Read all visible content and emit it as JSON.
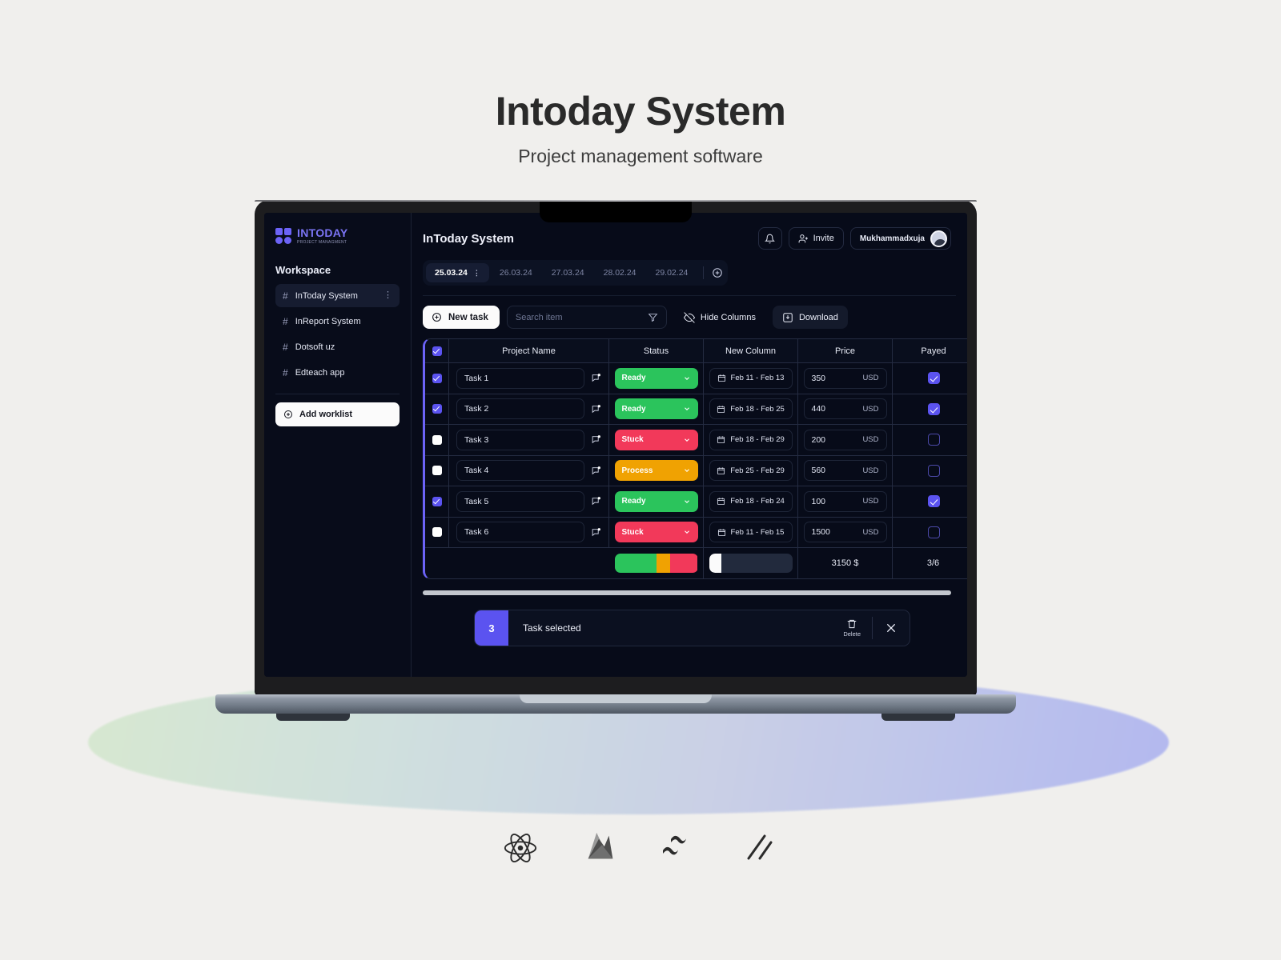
{
  "heading": {
    "title": "Intoday System",
    "subtitle": "Project management software"
  },
  "sidebar": {
    "logo": {
      "name": "INTODAY",
      "tagline": "PROJECT MANAGMENT"
    },
    "workspace_label": "Workspace",
    "items": [
      {
        "hash": "#",
        "label": "InToday System",
        "active": true
      },
      {
        "hash": "#",
        "label": "InReport System",
        "active": false
      },
      {
        "hash": "#",
        "label": "Dotsoft uz",
        "active": false
      },
      {
        "hash": "#",
        "label": "Edteach app",
        "active": false
      }
    ],
    "add_worklist_label": "Add worklist"
  },
  "topbar": {
    "app_title": "InToday System",
    "invite_label": "Invite",
    "user_name": "Mukhammadxuja"
  },
  "dates": {
    "tabs": [
      {
        "label": "25.03.24",
        "active": true
      },
      {
        "label": "26.03.24",
        "active": false
      },
      {
        "label": "27.03.24",
        "active": false
      },
      {
        "label": "28.02.24",
        "active": false
      },
      {
        "label": "29.02.24",
        "active": false
      }
    ]
  },
  "toolbar": {
    "new_task_label": "New task",
    "search_placeholder": "Search item",
    "search_value": "",
    "hide_columns_label": "Hide Columns",
    "download_label": "Download"
  },
  "table": {
    "headers": [
      "Project Name",
      "Status",
      "New Column",
      "Price",
      "Payed"
    ],
    "header_checked": true,
    "rows": [
      {
        "selected": true,
        "name": "Task 1",
        "status": "Ready",
        "status_color": "#2BC45C",
        "date": "Feb 11 - Feb 13",
        "price": "350",
        "currency": "USD",
        "payed": true
      },
      {
        "selected": true,
        "name": "Task 2",
        "status": "Ready",
        "status_color": "#2BC45C",
        "date": "Feb 18 - Feb 25",
        "price": "440",
        "currency": "USD",
        "payed": true
      },
      {
        "selected": false,
        "name": "Task 3",
        "status": "Stuck",
        "status_color": "#F2395A",
        "date": "Feb 18 - Feb 29",
        "price": "200",
        "currency": "USD",
        "payed": false
      },
      {
        "selected": false,
        "name": "Task 4",
        "status": "Process",
        "status_color": "#F0A202",
        "date": "Feb 25 - Feb 29",
        "price": "560",
        "currency": "USD",
        "payed": false
      },
      {
        "selected": true,
        "name": "Task 5",
        "status": "Ready",
        "status_color": "#2BC45C",
        "date": "Feb 18 - Feb 24",
        "price": "100",
        "currency": "USD",
        "payed": true
      },
      {
        "selected": false,
        "name": "Task 6",
        "status": "Stuck",
        "status_color": "#F2395A",
        "date": "Feb 11 - Feb 15",
        "price": "1500",
        "currency": "USD",
        "payed": false
      }
    ],
    "footer": {
      "segments": [
        {
          "label": "Ready",
          "color": "#2BC45C",
          "percent": 50
        },
        {
          "label": "Process",
          "color": "#F0A202",
          "percent": 17
        },
        {
          "label": "Stuck",
          "color": "#F2395A",
          "percent": 33
        }
      ],
      "progress_percent": 15,
      "total": "3150 $",
      "payed_ratio": "3/6"
    }
  },
  "toast": {
    "count": "3",
    "message": "Task selected",
    "delete_label": "Delete"
  },
  "tech_stack": [
    "react-icon",
    "firebase-icon",
    "tailwind-icon",
    "slashes-icon"
  ],
  "colors": {
    "accent": "#5B53F0",
    "ready": "#2BC45C",
    "stuck": "#F2395A",
    "process": "#F0A202",
    "screen_bg": "#070B19"
  }
}
